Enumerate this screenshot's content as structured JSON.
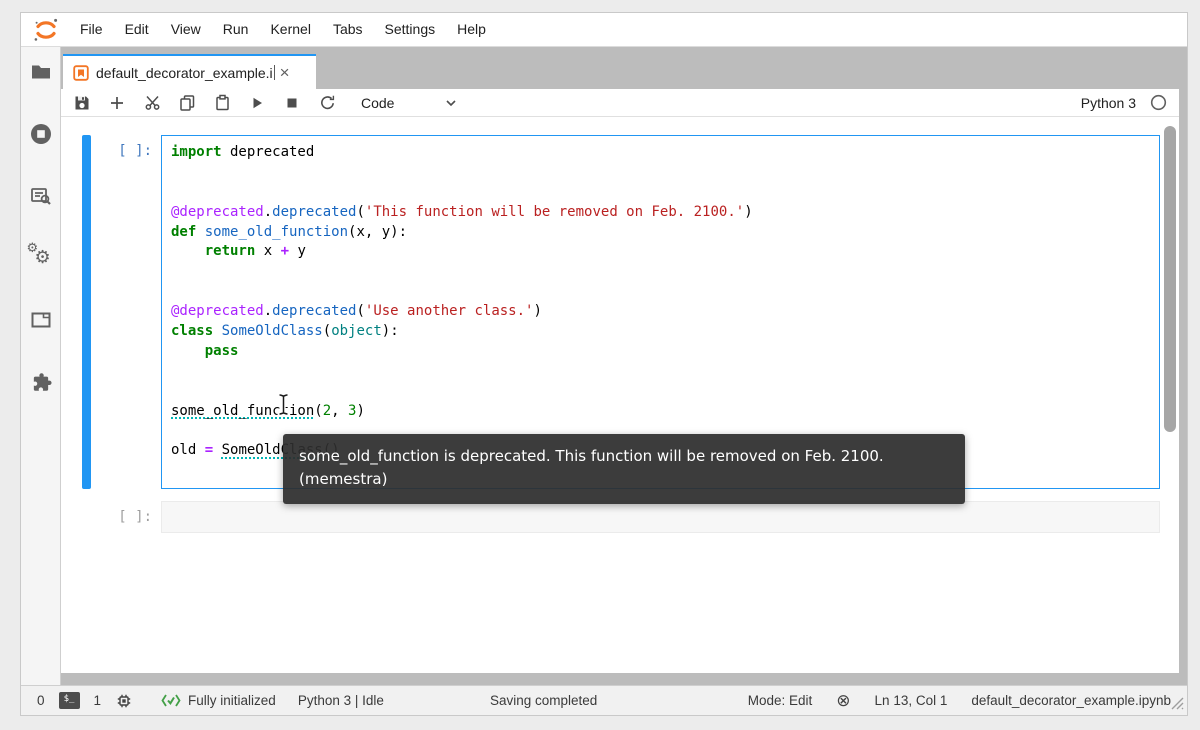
{
  "colors": {
    "accent": "#2196f3",
    "logo_orange": "#f37626",
    "keyword": "#008000",
    "string": "#ba2121",
    "decorator": "#aa22ff",
    "function_name": "#1665c0",
    "builtin": "#008080",
    "number": "#008000",
    "diagnostic_underline": "#00b5b5",
    "dock_background": "#bcbcbc"
  },
  "icons": {
    "close": "×",
    "gear": "⚙",
    "not_trusted": "⊗",
    "terminal_label": "$_"
  },
  "menu": {
    "items": [
      "File",
      "Edit",
      "View",
      "Run",
      "Kernel",
      "Tabs",
      "Settings",
      "Help"
    ]
  },
  "tab": {
    "title": "default_decorator_example.i"
  },
  "toolbar": {
    "cell_type": "Code",
    "kernel_name": "Python 3"
  },
  "notebook": {
    "cell1": {
      "prompt": "[ ]:",
      "lines": [
        [
          {
            "c": "k",
            "t": "import"
          },
          {
            "c": "p",
            "t": " deprecated"
          }
        ],
        [],
        [],
        [
          {
            "c": "d",
            "t": "@deprecated"
          },
          {
            "c": "p",
            "t": "."
          },
          {
            "c": "f",
            "t": "deprecated"
          },
          {
            "c": "p",
            "t": "("
          },
          {
            "c": "s",
            "t": "'This function will be removed on Feb. 2100.'"
          },
          {
            "c": "p",
            "t": ")"
          }
        ],
        [
          {
            "c": "k",
            "t": "def"
          },
          {
            "c": "p",
            "t": " "
          },
          {
            "c": "f",
            "t": "some_old_function"
          },
          {
            "c": "p",
            "t": "(x, y):"
          }
        ],
        [
          {
            "c": "p",
            "t": "    "
          },
          {
            "c": "k",
            "t": "return"
          },
          {
            "c": "p",
            "t": " x "
          },
          {
            "c": "o",
            "t": "+"
          },
          {
            "c": "p",
            "t": " y"
          }
        ],
        [],
        [],
        [
          {
            "c": "d",
            "t": "@deprecated"
          },
          {
            "c": "p",
            "t": "."
          },
          {
            "c": "f",
            "t": "deprecated"
          },
          {
            "c": "p",
            "t": "("
          },
          {
            "c": "s",
            "t": "'Use another class.'"
          },
          {
            "c": "p",
            "t": ")"
          }
        ],
        [
          {
            "c": "k",
            "t": "class"
          },
          {
            "c": "p",
            "t": " "
          },
          {
            "c": "f",
            "t": "SomeOldClass"
          },
          {
            "c": "p",
            "t": "("
          },
          {
            "c": "b",
            "t": "object"
          },
          {
            "c": "p",
            "t": "):"
          }
        ],
        [
          {
            "c": "p",
            "t": "    "
          },
          {
            "c": "k",
            "t": "pass"
          }
        ],
        [],
        [],
        [
          {
            "c": "u",
            "t": "some_old_function"
          },
          {
            "c": "p",
            "t": "("
          },
          {
            "c": "n",
            "t": "2"
          },
          {
            "c": "p",
            "t": ", "
          },
          {
            "c": "n",
            "t": "3"
          },
          {
            "c": "p",
            "t": ")"
          }
        ],
        [],
        [
          {
            "c": "p",
            "t": "old "
          },
          {
            "c": "o",
            "t": "="
          },
          {
            "c": "p",
            "t": " "
          },
          {
            "c": "u",
            "t": "SomeOldClass"
          },
          {
            "c": "p",
            "t": "()"
          }
        ],
        []
      ]
    },
    "cell2": {
      "prompt": "[ ]:"
    }
  },
  "tooltip": {
    "line1": "some_old_function is deprecated. This function will be removed on Feb. 2100.",
    "line2": "(memestra)"
  },
  "statusbar": {
    "kernel_sessions": "0",
    "terminal_sessions": "1",
    "lsp_status": "Fully initialized",
    "kernel_indicator": "Python 3 | Idle",
    "save_status": "Saving completed",
    "mode": "Mode: Edit",
    "cursor_position": "Ln 13, Col 1",
    "filename": "default_decorator_example.ipynb"
  }
}
